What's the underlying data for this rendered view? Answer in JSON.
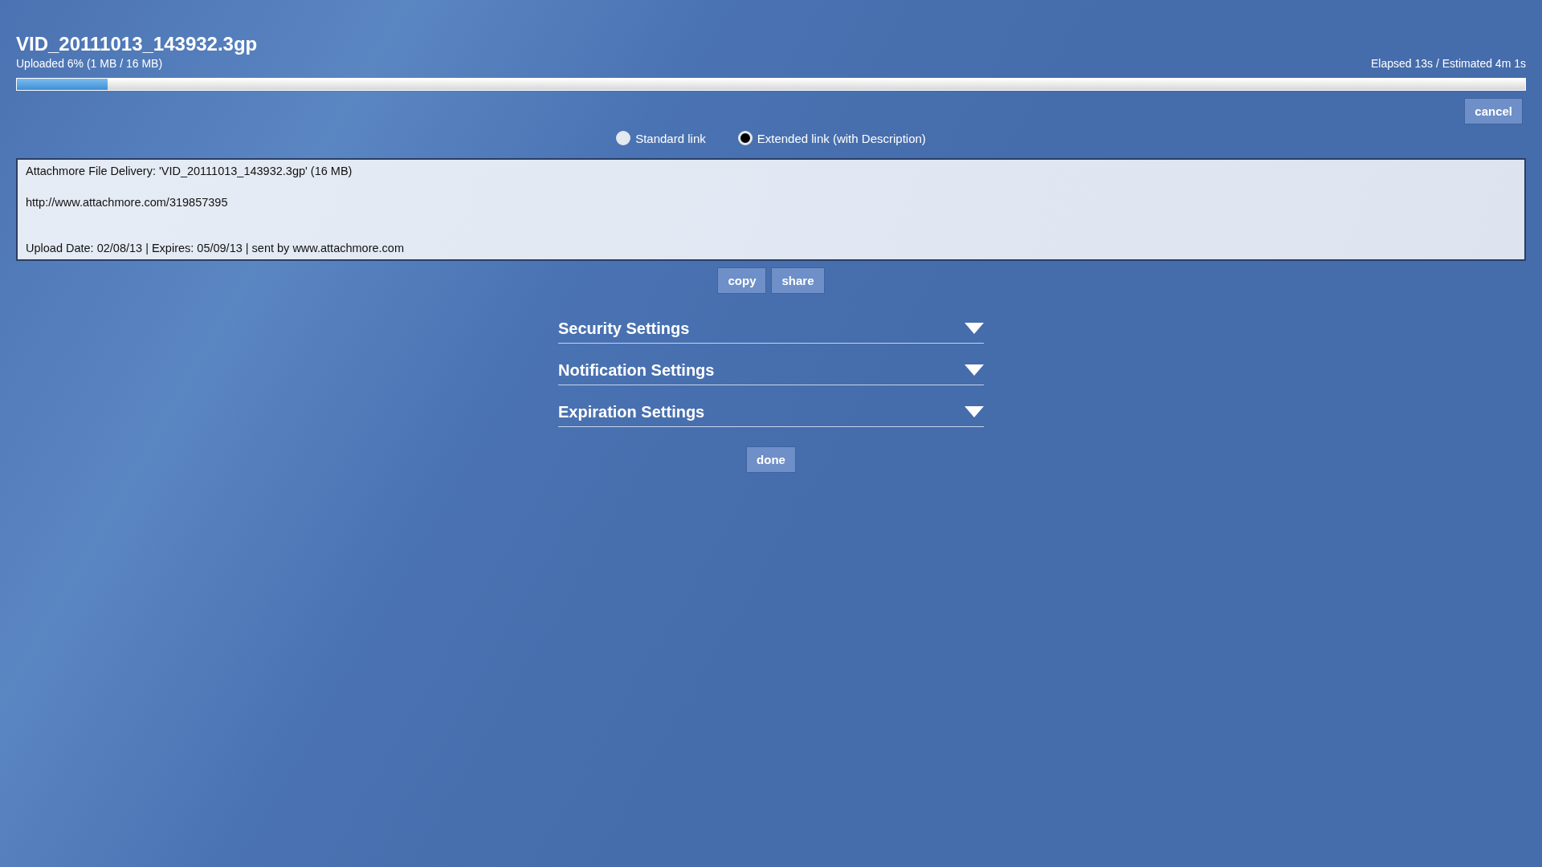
{
  "upload": {
    "file_name": "VID_20111013_143932.3gp",
    "status": "Uploaded 6% (1 MB / 16 MB)",
    "timing": "Elapsed  13s / Estimated  4m 1s",
    "level": 0.06
  },
  "cancel_button": "cancel",
  "link_types": [
    {
      "label": "Standard link",
      "selected": false
    },
    {
      "label": "Extended link (with Description)",
      "selected": true
    }
  ],
  "link_text": {
    "lines": [
      "Attachmore File Delivery: 'VID_20111013_143932.3gp' (16 MB)",
      "http://www.attachmore.com/319857395",
      "Upload Date: 02/08/13 | Expires: 05/09/13  | sent by www.attachmore.com"
    ]
  },
  "link_buttons": [
    "copy",
    "share"
  ],
  "settings_sections": [
    {
      "title": "Security Settings",
      "expanded": false
    },
    {
      "title": "Notification Settings",
      "expanded": false
    },
    {
      "title": "Expiration Settings",
      "expanded": false
    }
  ],
  "done_button": "done"
}
